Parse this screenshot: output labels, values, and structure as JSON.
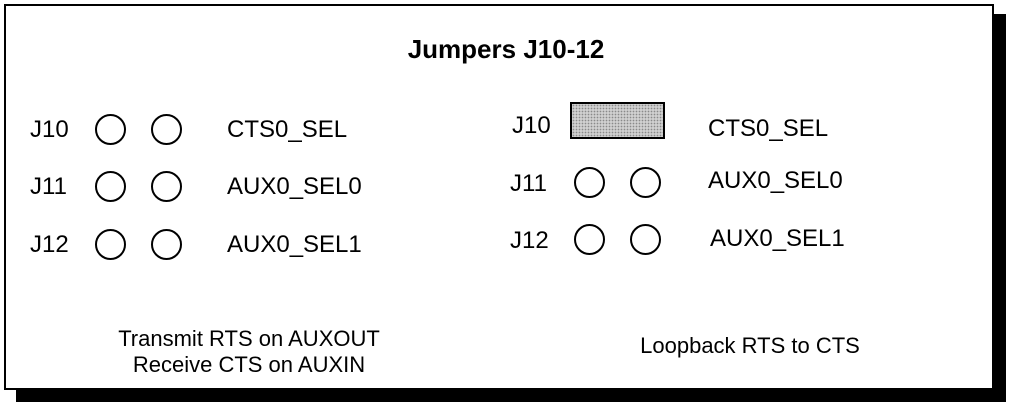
{
  "title": "Jumpers J10-12",
  "left_config": {
    "rows": [
      {
        "jumper": "J10",
        "signal": "CTS0_SEL",
        "shunt_installed": false
      },
      {
        "jumper": "J11",
        "signal": "AUX0_SEL0",
        "shunt_installed": false
      },
      {
        "jumper": "J12",
        "signal": "AUX0_SEL1",
        "shunt_installed": false
      }
    ],
    "caption_line1": "Transmit RTS on AUXOUT",
    "caption_line2": "Receive CTS on AUXIN"
  },
  "right_config": {
    "rows": [
      {
        "jumper": "J10",
        "signal": "CTS0_SEL",
        "shunt_installed": true
      },
      {
        "jumper": "J11",
        "signal": "AUX0_SEL0",
        "shunt_installed": false
      },
      {
        "jumper": "J12",
        "signal": "AUX0_SEL1",
        "shunt_installed": false
      }
    ],
    "caption": "Loopback RTS to CTS"
  },
  "colors": {
    "outline": "#000000",
    "shunt_fill": "#cfcfcf",
    "background": "#ffffff"
  }
}
